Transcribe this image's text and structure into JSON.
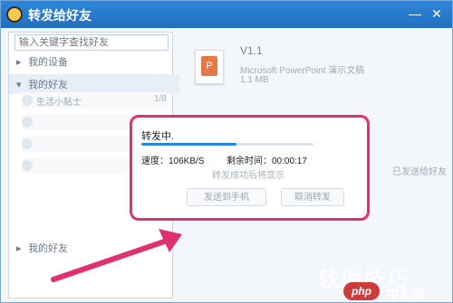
{
  "window": {
    "title": "转发给好友"
  },
  "left_panel": {
    "search_placeholder": "输入关键字查找好友",
    "groups": {
      "recent_devices": "我的设备",
      "my_friends": "我的好友",
      "recent_friends": "我的好友"
    },
    "rows": [
      {
        "label": "生活小贴士",
        "count": "1/8"
      },
      {
        "label": "",
        "count": ""
      },
      {
        "label": "",
        "count": ""
      },
      {
        "label": "",
        "count": ""
      }
    ]
  },
  "file": {
    "version": "V1.1",
    "description": "Microsoft PowerPoint 演示文稿",
    "size": "1.1 MB",
    "badge": "P"
  },
  "right_panel": {
    "send_note": "已发送给好友"
  },
  "dialog": {
    "status": "转发中.",
    "progress_fraction": 0.55,
    "speed_label": "速度：106KB/S",
    "remaining_label": "剩余时间：00:00:17",
    "hint": "转发成功后将显示",
    "phone_button": "发送到手机",
    "cancel_button": "取消转发"
  },
  "watermark": {
    "text": "软件技巧",
    "logo": "php",
    "site": "中文网"
  },
  "colors": {
    "accent": "#1f6fc2",
    "highlight": "#e0306e",
    "progress": "#2b86d6"
  }
}
